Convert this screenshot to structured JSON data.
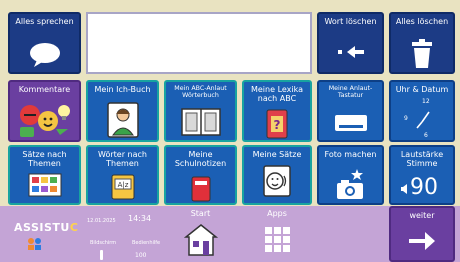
{
  "row1": {
    "speak_all": "Alles sprechen",
    "delete_word": "Wort löschen",
    "delete_all": "Alles löschen"
  },
  "row2": [
    {
      "label": "Kommentare"
    },
    {
      "label": "Mein Ich-Buch"
    },
    {
      "label": "Mein ABC-Anlaut Wörterbuch"
    },
    {
      "label": "Meine Lexika nach ABC"
    },
    {
      "label": "Meine Anlaut-Tastatur"
    },
    {
      "label": "Uhr & Datum",
      "clock_12": "12",
      "clock_9": "9",
      "clock_6": "6"
    }
  ],
  "row3": [
    {
      "label": "Sätze nach Themen"
    },
    {
      "label": "Wörter nach Themen",
      "book_text": "A|z"
    },
    {
      "label": "Meine Schulnotizen"
    },
    {
      "label": "Meine Sätze"
    },
    {
      "label": "Foto machen"
    },
    {
      "label": "Lautstärke Stimme",
      "value": "90"
    }
  ],
  "bottom": {
    "brand_main": "ASSISTU",
    "brand_accent": "C",
    "date": "12.01.2025",
    "time": "14:34",
    "sub_left": "Bildschirm",
    "sub_right": "Bedienhilfe",
    "volume": "100",
    "start": "Start",
    "apps": "Apps",
    "next": "weiter"
  },
  "colors": {
    "tile_blue": "#1b5fb4",
    "tile_navy": "#1c3b85",
    "tile_purple": "#6a3fa0",
    "bar_lilac": "#c4a4d6",
    "background": "#e9e3c1"
  }
}
